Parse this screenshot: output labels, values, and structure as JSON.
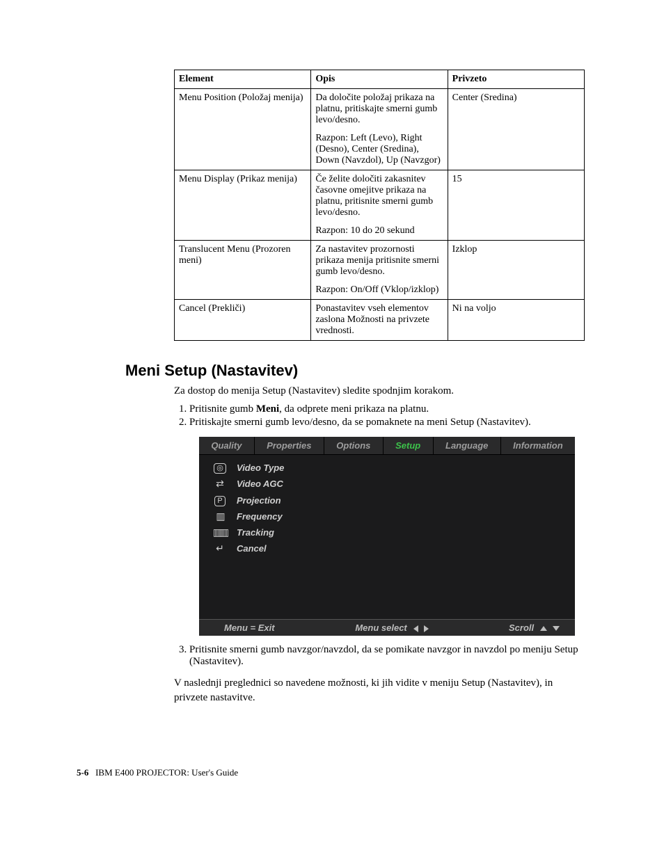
{
  "table": {
    "headers": [
      "Element",
      "Opis",
      "Privzeto"
    ],
    "rows": [
      {
        "el": "Menu Position (Položaj menija)",
        "desc1": "Da določite položaj prikaza na platnu, pritiskajte smerni gumb levo/desno.",
        "desc2": "Razpon: Left (Levo), Right (Desno), Center (Sredina), Down (Navzdol), Up (Navzgor)",
        "def": "Center (Sredina)"
      },
      {
        "el": "Menu Display (Prikaz menija)",
        "desc1": "Če želite določiti zakasnitev časovne omejitve prikaza na platnu, pritisnite smerni gumb levo/desno.",
        "desc2": "Razpon: 10 do 20 sekund",
        "def": "15"
      },
      {
        "el": "Translucent Menu (Prozoren meni)",
        "desc1": "Za nastavitev prozornosti prikaza menija pritisnite smerni gumb levo/desno.",
        "desc2": "Razpon: On/Off (Vklop/izklop)",
        "def": "Izklop"
      },
      {
        "el": "Cancel (Prekliči)",
        "desc1": "Ponastavitev vseh elementov zaslona Možnosti na privzete vrednosti.",
        "desc2": "",
        "def": "Ni na voljo"
      }
    ]
  },
  "heading": "Meni Setup (Nastavitev)",
  "intro": "Za dostop do menija Setup (Nastavitev) sledite spodnjim korakom.",
  "steps12": [
    {
      "pre": "Pritisnite gumb ",
      "bold": "Meni",
      "post": ", da odprete meni prikaza na platnu."
    },
    {
      "pre": "Pritiskajte smerni gumb levo/desno, da se pomaknete na meni Setup (Nastavitev).",
      "bold": "",
      "post": ""
    }
  ],
  "osd": {
    "tabs": [
      "Quality",
      "Properties",
      "Options",
      "Setup",
      "Language",
      "Information"
    ],
    "active_index": 3,
    "items": [
      {
        "icon": "target-icon",
        "label": "Video Type"
      },
      {
        "icon": "slider-icon",
        "label": "Video AGC"
      },
      {
        "icon": "p-icon",
        "label": "Projection"
      },
      {
        "icon": "bars3-icon",
        "label": "Frequency"
      },
      {
        "icon": "bars4-icon",
        "label": "Tracking"
      },
      {
        "icon": "return-icon",
        "label": "Cancel"
      }
    ],
    "footer": {
      "left": "Menu = Exit",
      "center": "Menu select",
      "right": "Scroll"
    }
  },
  "step3": "Pritisnite smerni gumb navzgor/navzdol, da se pomikate navzgor in navzdol po meniju Setup (Nastavitev).",
  "closing": "V naslednji preglednici so navedene možnosti, ki jih vidite v meniju Setup (Nastavitev), in privzete nastavitve.",
  "footer": {
    "pagenum": "5-6",
    "title": "IBM E400 PROJECTOR: User's Guide"
  }
}
